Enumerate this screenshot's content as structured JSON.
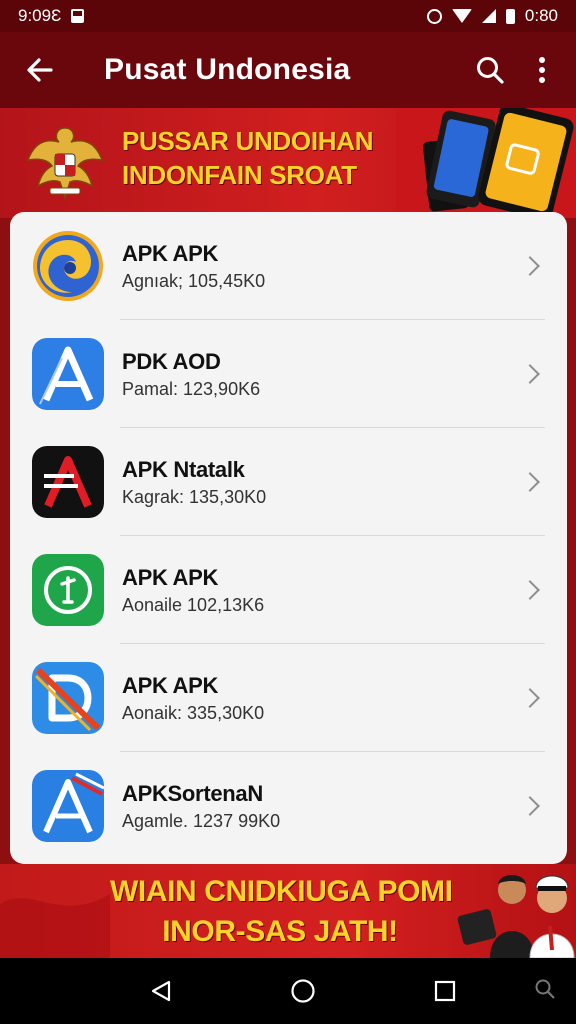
{
  "status_bar": {
    "time_left": "9:09Ɛ",
    "time_right": "0:80"
  },
  "app_bar": {
    "title": "Pusat Undonesia",
    "icons": {
      "back": "arrow-left-icon",
      "search": "search-icon",
      "more": "more-vert-icon"
    }
  },
  "banner": {
    "line1": "PUSSAR UNDOIHAN",
    "line2": "INDONFAIN SROAT"
  },
  "apps": [
    {
      "name": "APK APK",
      "meta": "Agnıak; 105,45K0",
      "icon": "swirl-app-icon"
    },
    {
      "name": "PDK AOD",
      "meta": "Pamal: 123,90K6",
      "icon": "a-letter-blue-icon"
    },
    {
      "name": "APK Ntatalk",
      "meta": "Kagrak: 135,30K0",
      "icon": "a-letter-black-icon"
    },
    {
      "name": "APK APK",
      "meta": "Aonaile 102,13K6",
      "icon": "green-circle-app-icon"
    },
    {
      "name": "APK APK",
      "meta": "Aonaik: 335,30K0",
      "icon": "d-letter-blue-icon"
    },
    {
      "name": "APKSortenaN",
      "meta": "Agamle. 1237 99K0",
      "icon": "a-letter-striped-icon"
    }
  ],
  "bottom_banner": {
    "line1": "WIAIN CNIDKIUGA POMI",
    "line2": "INOR-SAS JATH!"
  },
  "colors": {
    "brand_dark": "#6a070c",
    "brand_red": "#c21a1a",
    "banner_yellow": "#f8d42a",
    "card": "#f4f4f4"
  }
}
